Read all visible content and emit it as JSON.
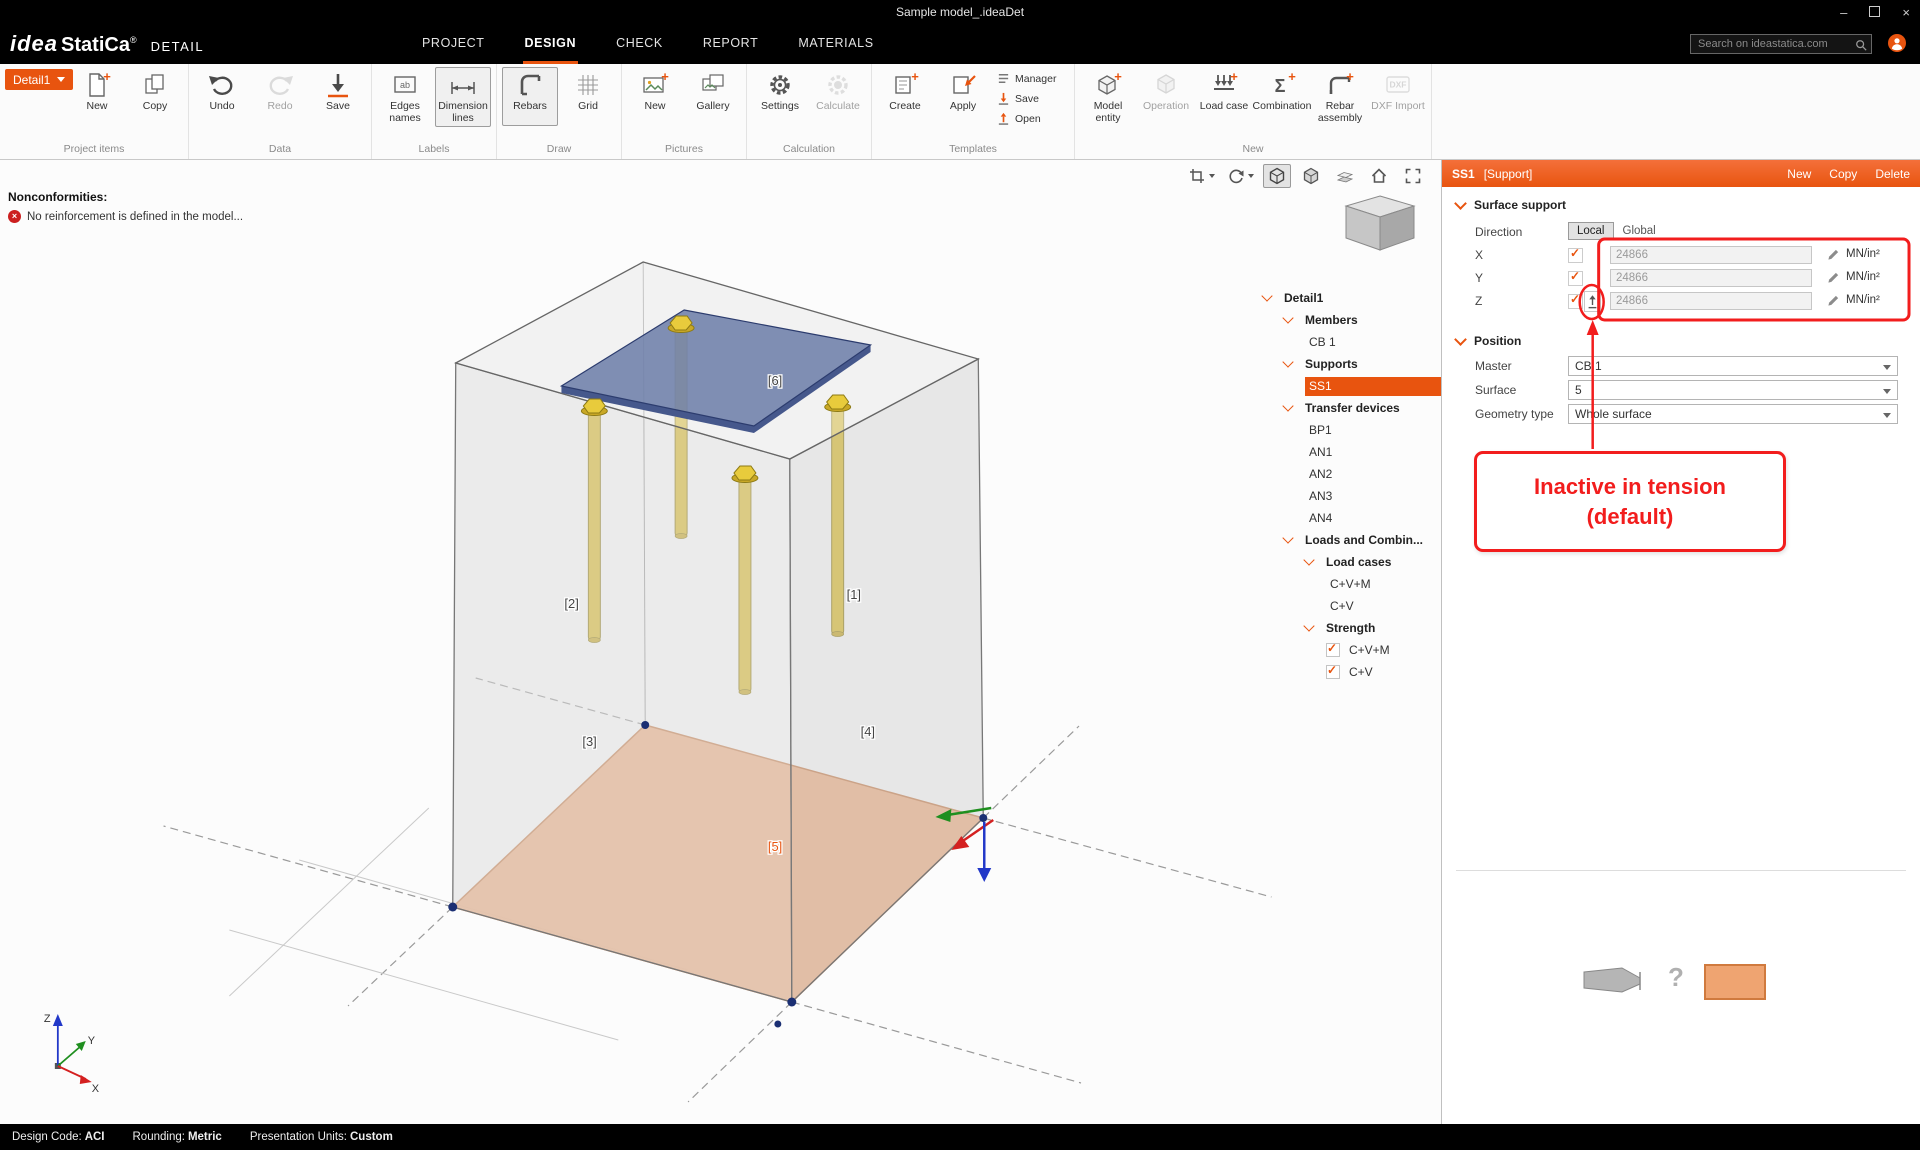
{
  "colors": {
    "accent": "#E8540F",
    "annotation_red": "#F21D1D",
    "support_face": "#EFA878",
    "plate_blue": "#6B7CA8",
    "bolt_yellow": "#E8CB3C"
  },
  "title_bar": {
    "title": "Sample model_.ideaDet",
    "controls": [
      "minimize-icon",
      "maximize-icon",
      "close-icon"
    ]
  },
  "menu_bar": {
    "logo": {
      "idea": "idea",
      "statica": "StatiCa",
      "registered": "®",
      "module": "DETAIL"
    },
    "tabs": [
      {
        "label": "PROJECT",
        "active": false
      },
      {
        "label": "DESIGN",
        "active": true
      },
      {
        "label": "CHECK",
        "active": false
      },
      {
        "label": "REPORT",
        "active": false
      },
      {
        "label": "MATERIALS",
        "active": false
      }
    ],
    "search_placeholder": "Search on ideastatica.com"
  },
  "ribbon": {
    "project_button": {
      "label": "Detail1"
    },
    "groups": [
      {
        "name": "Project items",
        "items": [
          {
            "label": "New",
            "icon": "new-doc"
          },
          {
            "label": "Copy",
            "icon": "copy"
          }
        ]
      },
      {
        "name": "Data",
        "items": [
          {
            "label": "Undo",
            "icon": "undo"
          },
          {
            "label": "Redo",
            "icon": "redo",
            "disabled": true
          },
          {
            "label": "Save",
            "icon": "save"
          }
        ]
      },
      {
        "name": "Labels",
        "items": [
          {
            "label": "Edges names",
            "icon": "edges-names"
          },
          {
            "label": "Dimension lines",
            "icon": "dimension-lines",
            "selected": true
          }
        ]
      },
      {
        "name": "Draw",
        "items": [
          {
            "label": "Rebars",
            "icon": "rebars",
            "selected": true
          },
          {
            "label": "Grid",
            "icon": "grid"
          }
        ]
      },
      {
        "name": "Pictures",
        "items": [
          {
            "label": "New",
            "icon": "picture-new"
          },
          {
            "label": "Gallery",
            "icon": "gallery"
          }
        ]
      },
      {
        "name": "Calculation",
        "items": [
          {
            "label": "Settings",
            "icon": "settings"
          },
          {
            "label": "Calculate",
            "icon": "calculate",
            "disabled": true
          }
        ]
      },
      {
        "name": "Templates",
        "items": [
          {
            "label": "Create",
            "icon": "template-create"
          },
          {
            "label": "Apply",
            "icon": "template-apply"
          }
        ],
        "stack": [
          {
            "label": "Manager",
            "icon": "manager"
          },
          {
            "label": "Save",
            "icon": "save-small"
          },
          {
            "label": "Open",
            "icon": "open"
          }
        ]
      },
      {
        "name": "New",
        "items": [
          {
            "label": "Model entity",
            "icon": "model-entity"
          },
          {
            "label": "Operation",
            "icon": "operation",
            "disabled": true
          },
          {
            "label": "Load case",
            "icon": "load-case"
          },
          {
            "label": "Combination",
            "icon": "combination"
          },
          {
            "label": "Rebar assembly",
            "icon": "rebar-assembly"
          },
          {
            "label": "DXF Import",
            "icon": "dxf-import",
            "disabled": true
          }
        ]
      }
    ]
  },
  "viewport": {
    "nonconformities_title": "Nonconformities:",
    "nonconformities_message": "No reinforcement is defined in the model...",
    "toolbar": [
      {
        "icon": "section-view",
        "dropdown": true
      },
      {
        "icon": "rotate-view",
        "dropdown": true
      },
      {
        "icon": "perspective-view",
        "active": true
      },
      {
        "icon": "solid-view"
      },
      {
        "icon": "faces-view"
      },
      {
        "icon": "home-view"
      },
      {
        "icon": "fit-view"
      }
    ],
    "labels": [
      "[1]",
      "[2]",
      "[3]",
      "[4]",
      "[5]",
      "[6]"
    ],
    "axes": {
      "x": "X",
      "y": "Y",
      "z": "Z"
    }
  },
  "tree": {
    "items": [
      {
        "label": "Detail1",
        "depth": 0,
        "chevron": true,
        "bold": true
      },
      {
        "label": "Members",
        "depth": 1,
        "chevron": true,
        "bold": true
      },
      {
        "label": "CB 1",
        "depth": 2
      },
      {
        "label": "Supports",
        "depth": 1,
        "chevron": true,
        "bold": true
      },
      {
        "label": "SS1",
        "depth": 2,
        "selected": true
      },
      {
        "label": "Transfer devices",
        "depth": 1,
        "chevron": true,
        "bold": true
      },
      {
        "label": "BP1",
        "depth": 2
      },
      {
        "label": "AN1",
        "depth": 2
      },
      {
        "label": "AN2",
        "depth": 2
      },
      {
        "label": "AN3",
        "depth": 2
      },
      {
        "label": "AN4",
        "depth": 2
      },
      {
        "label": "Loads and Combin...",
        "depth": 1,
        "chevron": true,
        "bold": true
      },
      {
        "label": "Load cases",
        "depth": 2,
        "chevron": true,
        "bold": true
      },
      {
        "label": "C+V+M",
        "depth": 3
      },
      {
        "label": "C+V",
        "depth": 3
      },
      {
        "label": "Strength",
        "depth": 2,
        "chevron": true,
        "bold": true
      },
      {
        "label": "C+V+M",
        "depth": 3,
        "checked": true
      },
      {
        "label": "C+V",
        "depth": 3,
        "checked": true
      }
    ]
  },
  "properties": {
    "header": {
      "title": "SS1",
      "subtitle": "[Support]",
      "buttons": [
        "New",
        "Copy",
        "Delete"
      ]
    },
    "surface_support": {
      "section_title": "Surface support",
      "direction_label": "Direction",
      "options": [
        "Local",
        "Global"
      ],
      "selected_option": "Local",
      "rows": [
        {
          "axis": "X",
          "checked": true,
          "value": "24866",
          "unit": "MN/in²"
        },
        {
          "axis": "Y",
          "checked": true,
          "value": "24866",
          "unit": "MN/in²"
        },
        {
          "axis": "Z",
          "checked": true,
          "value": "24866",
          "unit": "MN/in²",
          "tension_icon": true
        }
      ]
    },
    "position": {
      "section_title": "Position",
      "fields": [
        {
          "label": "Master",
          "value": "CB 1"
        },
        {
          "label": "Surface",
          "value": "5"
        },
        {
          "label": "Geometry type",
          "value": "Whole surface"
        }
      ]
    },
    "annotation": {
      "line1": "Inactive in tension",
      "line2": "(default)"
    },
    "behavior_diagram": {
      "question": "?"
    }
  },
  "status_bar": {
    "items": [
      {
        "label": "Design Code:",
        "value": "ACI"
      },
      {
        "label": "Rounding:",
        "value": "Metric"
      },
      {
        "label": "Presentation Units:",
        "value": "Custom"
      }
    ]
  }
}
